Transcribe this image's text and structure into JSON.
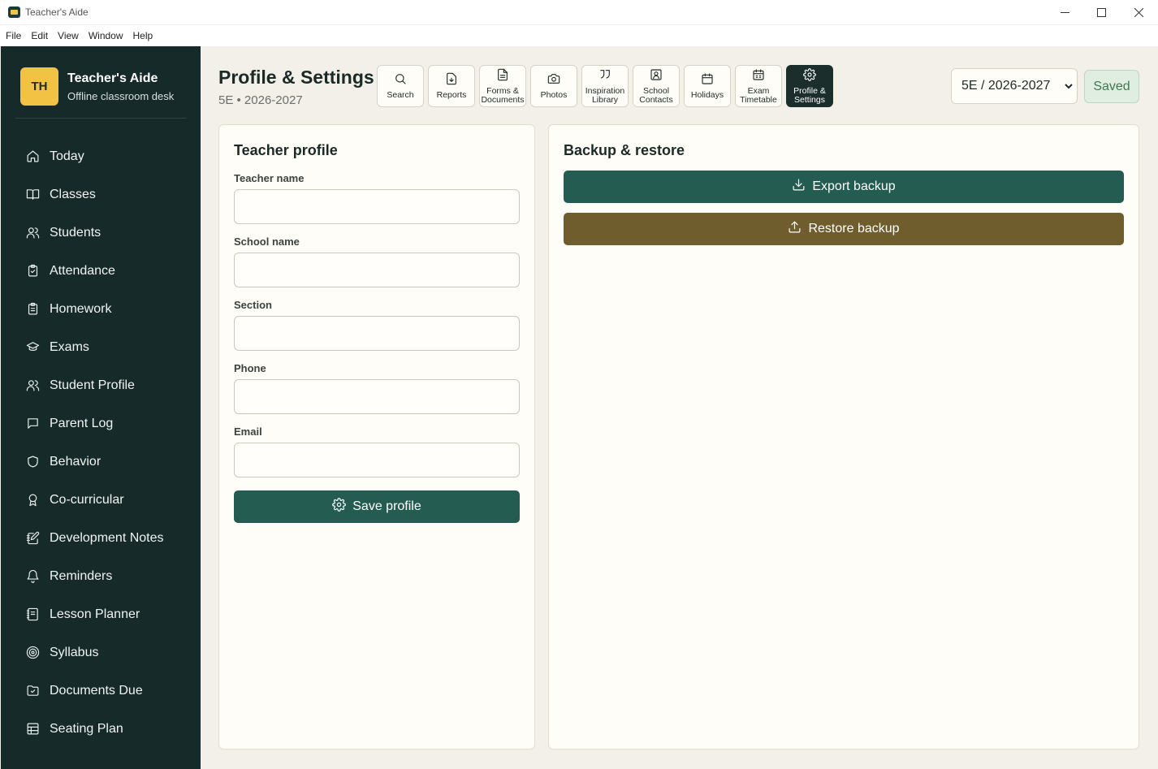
{
  "window": {
    "title": "Teacher's Aide",
    "menu": [
      "File",
      "Edit",
      "View",
      "Window",
      "Help"
    ]
  },
  "brand": {
    "initials": "TH",
    "name": "Teacher's Aide",
    "subtitle": "Offline classroom desk"
  },
  "sidebar": {
    "items": [
      {
        "label": "Today",
        "icon": "home-icon"
      },
      {
        "label": "Classes",
        "icon": "book-icon"
      },
      {
        "label": "Students",
        "icon": "users-icon"
      },
      {
        "label": "Attendance",
        "icon": "clipboard-check-icon"
      },
      {
        "label": "Homework",
        "icon": "clipboard-list-icon"
      },
      {
        "label": "Exams",
        "icon": "graduation-cap-icon"
      },
      {
        "label": "Student Profile",
        "icon": "users-icon"
      },
      {
        "label": "Parent Log",
        "icon": "message-square-icon"
      },
      {
        "label": "Behavior",
        "icon": "shield-icon"
      },
      {
        "label": "Co-curricular",
        "icon": "award-icon"
      },
      {
        "label": "Development Notes",
        "icon": "notebook-pen-icon"
      },
      {
        "label": "Reminders",
        "icon": "bell-icon"
      },
      {
        "label": "Lesson Planner",
        "icon": "notebook-icon"
      },
      {
        "label": "Syllabus",
        "icon": "target-icon"
      },
      {
        "label": "Documents Due",
        "icon": "folder-icon"
      },
      {
        "label": "Seating Plan",
        "icon": "layout-grid-icon"
      }
    ]
  },
  "header": {
    "title": "Profile & Settings",
    "subtitle": "5E • 2026-2027",
    "class_select": "5E / 2026-2027",
    "status": "Saved"
  },
  "toolbar": {
    "tools": [
      {
        "label": "Search",
        "icon": "search-icon"
      },
      {
        "label": "Reports",
        "icon": "file-download-icon"
      },
      {
        "label": "Forms &\nDocuments",
        "icon": "file-text-icon"
      },
      {
        "label": "Photos",
        "icon": "camera-icon"
      },
      {
        "label": "Inspiration\nLibrary",
        "icon": "quote-icon"
      },
      {
        "label": "School\nContacts",
        "icon": "contact-icon"
      },
      {
        "label": "Holidays",
        "icon": "calendar-icon"
      },
      {
        "label": "Exam\nTimetable",
        "icon": "calendar-grid-icon"
      },
      {
        "label": "Profile &\nSettings",
        "icon": "gear-icon",
        "active": true
      }
    ]
  },
  "profile": {
    "heading": "Teacher profile",
    "fields": [
      {
        "label": "Teacher name",
        "value": ""
      },
      {
        "label": "School name",
        "value": ""
      },
      {
        "label": "Section",
        "value": ""
      },
      {
        "label": "Phone",
        "value": ""
      },
      {
        "label": "Email",
        "value": ""
      }
    ],
    "save_label": "Save profile"
  },
  "backup": {
    "heading": "Backup & restore",
    "export_label": "Export backup",
    "restore_label": "Restore backup"
  },
  "colors": {
    "sidebar": "#162a2a",
    "accent_green": "#245c51",
    "accent_olive": "#6f5d2e",
    "brand_yellow": "#f2c245"
  }
}
